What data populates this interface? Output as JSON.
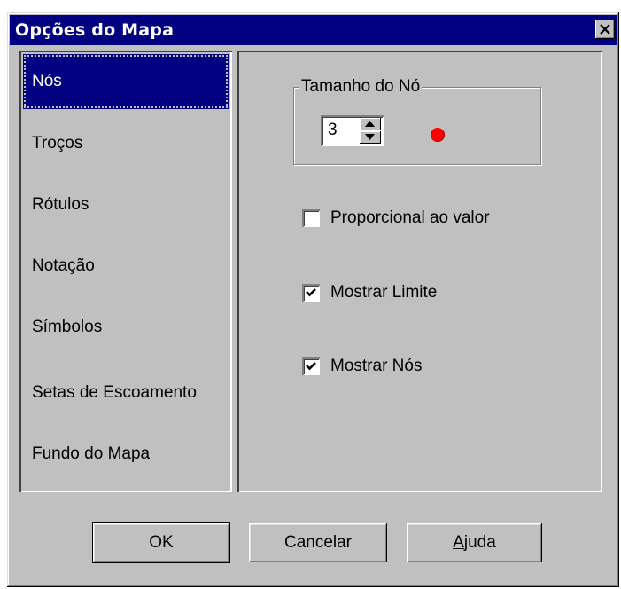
{
  "window": {
    "title": "Opções do Mapa"
  },
  "sidebar": {
    "items": [
      {
        "label": "Nós",
        "selected": true
      },
      {
        "label": "Troços",
        "selected": false
      },
      {
        "label": "Rótulos",
        "selected": false
      },
      {
        "label": "Notação",
        "selected": false
      },
      {
        "label": "Símbolos",
        "selected": false
      },
      {
        "label": "Setas de Escoamento",
        "selected": false
      },
      {
        "label": "Fundo do Mapa",
        "selected": false
      }
    ]
  },
  "panel": {
    "node_size": {
      "legend": "Tamanho do Nó",
      "value": "3",
      "dot_color": "#ff0000"
    },
    "proportional": {
      "label": "Proporcional ao valor",
      "checked": false
    },
    "show_border": {
      "label": "Mostrar Limite",
      "checked": true
    },
    "show_nodes": {
      "label": "Mostrar Nós",
      "checked": true
    }
  },
  "buttons": {
    "ok": "OK",
    "cancel": "Cancelar",
    "help_first": "A",
    "help_rest": "juda"
  },
  "colors": {
    "titlebar": "#000080",
    "face": "#c0c0c0",
    "selection": "#000080"
  }
}
